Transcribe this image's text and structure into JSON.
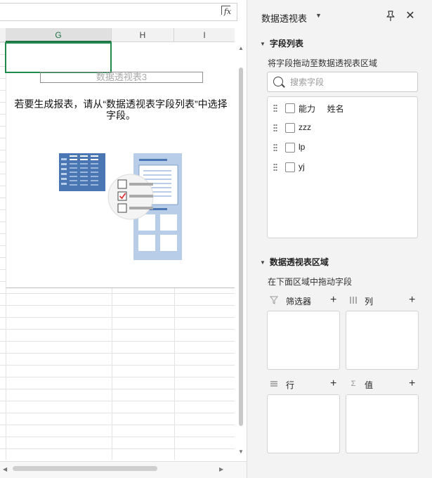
{
  "sheet": {
    "formula_bar": {
      "fx_label": "fx"
    },
    "columns": [
      "G",
      "H",
      "I"
    ],
    "pivot": {
      "name": "数据透视表3",
      "hint": "若要生成报表，请从“数据透视表字段列表”中选择字段。"
    }
  },
  "pane": {
    "title": "数据透视表",
    "field_section": {
      "title": "字段列表",
      "subtitle": "将字段拖动至数据透视表区域",
      "search_placeholder": "搜索字段",
      "fields": [
        {
          "label": "能力     姓名",
          "checked": false
        },
        {
          "label": "zzz",
          "checked": false
        },
        {
          "label": "lp",
          "checked": false
        },
        {
          "label": "yj",
          "checked": false
        }
      ]
    },
    "areas_section": {
      "title": "数据透视表区域",
      "subtitle": "在下面区域中拖动字段",
      "areas": {
        "filter": {
          "label": "筛选器",
          "icon": "filter-icon"
        },
        "columns": {
          "label": "列",
          "icon": "columns-icon"
        },
        "rows": {
          "label": "行",
          "icon": "rows-icon"
        },
        "values": {
          "label": "值",
          "icon": "sigma-icon"
        }
      }
    }
  },
  "colors": {
    "accent_green": "#1e8a4c",
    "illustration_blue": "#4a77b4",
    "illustration_light": "#b8cde8"
  }
}
